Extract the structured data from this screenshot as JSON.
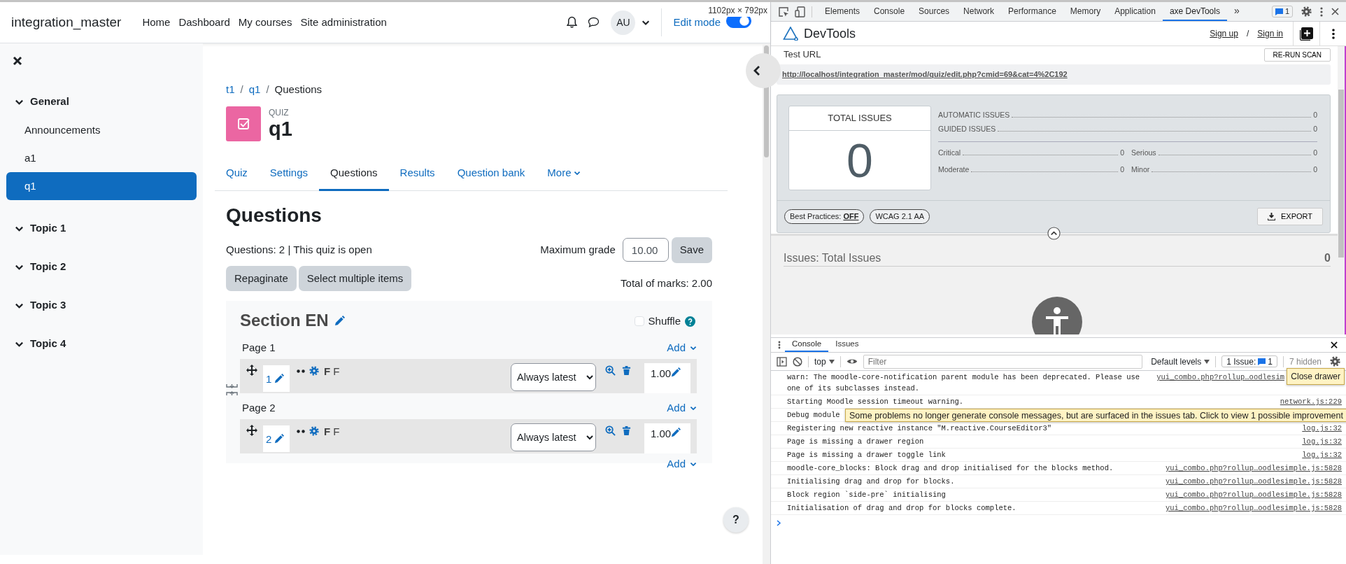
{
  "viewport_label": "1102px × 792px",
  "navbar": {
    "brand": "integration_master",
    "links": [
      "Home",
      "Dashboard",
      "My courses",
      "Site administration"
    ],
    "avatar": "AU",
    "edit_mode": {
      "label": "Edit mode",
      "on": true
    }
  },
  "course_index": [
    {
      "label": "General",
      "expanded": true,
      "children": [
        {
          "label": "Announcements",
          "selected": false
        },
        {
          "label": "a1",
          "selected": false
        },
        {
          "label": "q1",
          "selected": true
        }
      ]
    },
    {
      "label": "Topic 1",
      "expanded": true
    },
    {
      "label": "Topic 2",
      "expanded": true
    },
    {
      "label": "Topic 3",
      "expanded": true
    },
    {
      "label": "Topic 4",
      "expanded": true
    }
  ],
  "breadcrumb": {
    "items": [
      {
        "label": "t1",
        "current": false
      },
      {
        "label": "q1",
        "current": false
      },
      {
        "label": "Questions",
        "current": true
      }
    ],
    "separators": [
      "/",
      "/"
    ]
  },
  "activity": {
    "type_label": "QUIZ",
    "title": "q1"
  },
  "main_tabs": [
    {
      "label": "Quiz",
      "selected": false,
      "dropdown": false
    },
    {
      "label": "Settings",
      "selected": false,
      "dropdown": false
    },
    {
      "label": "Questions",
      "selected": true,
      "dropdown": false
    },
    {
      "label": "Results",
      "selected": false,
      "dropdown": false
    },
    {
      "label": "Question bank",
      "selected": false,
      "dropdown": false
    },
    {
      "label": "More",
      "selected": false,
      "dropdown": true
    }
  ],
  "heading": "Questions",
  "summary": "Questions: 2 | This quiz is open",
  "max_grade": {
    "label": "Maximum grade",
    "value": "10.00",
    "button": "Save"
  },
  "action_buttons": [
    "Repaginate",
    "Select multiple items"
  ],
  "total_marks": "Total of marks: 2.00",
  "section": {
    "title": "Section EN",
    "shuffle": {
      "label": "Shuffle",
      "checked": false
    },
    "add": "Add",
    "pages": [
      {
        "label": "Page 1",
        "add": "Add",
        "questions": [
          {
            "number": "1",
            "type_label": "F",
            "name": "F",
            "version": "Always latest",
            "mark": "1.00"
          }
        ]
      },
      {
        "label": "Page 2",
        "add": "Add",
        "questions": [
          {
            "number": "2",
            "type_label": "F",
            "name": "F",
            "version": "Always latest",
            "mark": "1.00"
          }
        ]
      }
    ]
  },
  "help_button": "?",
  "devtools": {
    "tabs": [
      {
        "label": "Elements",
        "selected": false
      },
      {
        "label": "Console",
        "selected": false
      },
      {
        "label": "Sources",
        "selected": false
      },
      {
        "label": "Network",
        "selected": false
      },
      {
        "label": "Performance",
        "selected": false
      },
      {
        "label": "Memory",
        "selected": false
      },
      {
        "label": "Application",
        "selected": false
      },
      {
        "label": "axe DevTools",
        "selected": true
      }
    ],
    "overflow": "»",
    "issues_badge": "1",
    "axe": {
      "brand": "DevTools",
      "sign_up": "Sign up",
      "separator": "/",
      "sign_in": "Sign in",
      "test_url_label": "Test URL",
      "rerun": "RE-RUN SCAN",
      "url": "http://localhost/integration_master/mod/quiz/edit.php?cmid=69&cat=4%2C192",
      "total_issues": {
        "label": "TOTAL ISSUES",
        "value": "0"
      },
      "counts": [
        {
          "label": "AUTOMATIC ISSUES",
          "value": "0"
        },
        {
          "label": "GUIDED ISSUES",
          "value": "0"
        }
      ],
      "severities": [
        {
          "label": "Critical",
          "value": "0"
        },
        {
          "label": "Serious",
          "value": "0"
        },
        {
          "label": "Moderate",
          "value": "0"
        },
        {
          "label": "Minor",
          "value": "0"
        }
      ],
      "best_practices": {
        "label": "Best Practices:",
        "state": "OFF"
      },
      "standard": "WCAG 2.1 AA",
      "export": "EXPORT",
      "issues_heading": "Issues: Total Issues",
      "issues_count": "0"
    },
    "drawer": {
      "tabs": [
        {
          "label": "Console",
          "selected": true
        },
        {
          "label": "Issues",
          "selected": false
        }
      ],
      "context": "top",
      "filter_placeholder": "Filter",
      "levels": "Default levels",
      "issues_button": {
        "label": "1 Issue:",
        "count": "1"
      },
      "hidden": "7 hidden",
      "messages": [
        {
          "text": "warn: The moodle-core-notification parent module has been deprecated. Please use one of its subclasses instead.",
          "source": "yui_combo.php?rollup…oodlesim"
        },
        {
          "text": "Starting Moodle session timeout warning.",
          "source": "network.js:229"
        },
        {
          "text": "Debug module"
        },
        {
          "text": "Registering new reactive instance \"M.reactive.CourseEditor3\"",
          "source": "log.js:32"
        },
        {
          "text": "Page is missing a drawer region",
          "source": "log.js:32"
        },
        {
          "text": "Page is missing a drawer toggle link",
          "source": "log.js:32"
        },
        {
          "text": "moodle-core_blocks: Block drag and drop initialised for the blocks method.",
          "source": "yui_combo.php?rollup…oodlesimple.js:5828"
        },
        {
          "text": "Initialising drag and drop for blocks.",
          "source": "yui_combo.php?rollup…oodlesimple.js:5828"
        },
        {
          "text": "Block region `side-pre` initialising",
          "source": "yui_combo.php?rollup…oodlesimple.js:5828"
        },
        {
          "text": "Initialisation of drag and drop for blocks complete.",
          "source": "yui_combo.php?rollup…oodlesimple.js:5828"
        }
      ],
      "close_tooltip": "Close drawer",
      "issues_tooltip": "Some problems no longer generate console messages, but are surfaced in the issues tab. Click to view 1 possible improvement"
    }
  }
}
